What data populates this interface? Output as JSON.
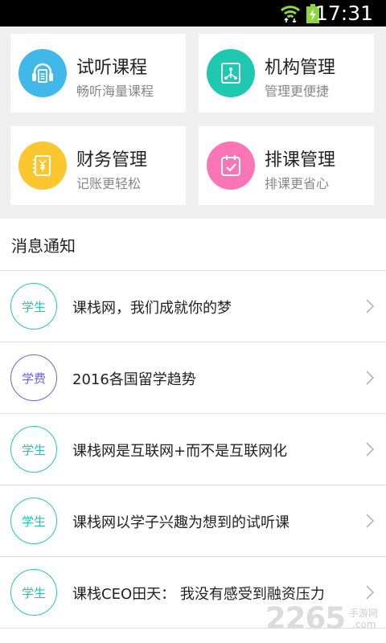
{
  "status_bar": {
    "time": "17:31"
  },
  "grid": [
    {
      "title": "试听课程",
      "subtitle": "畅听海量课程",
      "icon": "headphones-icon",
      "color": "#40b9ea"
    },
    {
      "title": "机构管理",
      "subtitle": "管理更便捷",
      "icon": "org-tree-icon",
      "color": "#1fc8b0"
    },
    {
      "title": "财务管理",
      "subtitle": "记账更轻松",
      "icon": "yuan-book-icon",
      "color": "#fcc72e"
    },
    {
      "title": "排课管理",
      "subtitle": "排课更省心",
      "icon": "calendar-icon",
      "color": "#f975b5"
    }
  ],
  "messages": {
    "section_title": "消息通知",
    "items": [
      {
        "tag": "学生",
        "text": "课栈网，我们成就你的梦",
        "color": "#26c4b6"
      },
      {
        "tag": "学费",
        "text": "2016各国留学趋势",
        "color": "#6c63d8"
      },
      {
        "tag": "学生",
        "text": "课栈网是互联网+而不是互联网化",
        "color": "#26c4b6"
      },
      {
        "tag": "学生",
        "text": "课栈网以学子兴趣为想到的试听课",
        "color": "#26c4b6"
      },
      {
        "tag": "学生",
        "text": "课栈CEO田天： 我没有感受到融资压力",
        "color": "#26c4b6"
      }
    ]
  },
  "watermark": {
    "number": "2265",
    "site_cn": "手游网",
    "site_en": ".com"
  }
}
